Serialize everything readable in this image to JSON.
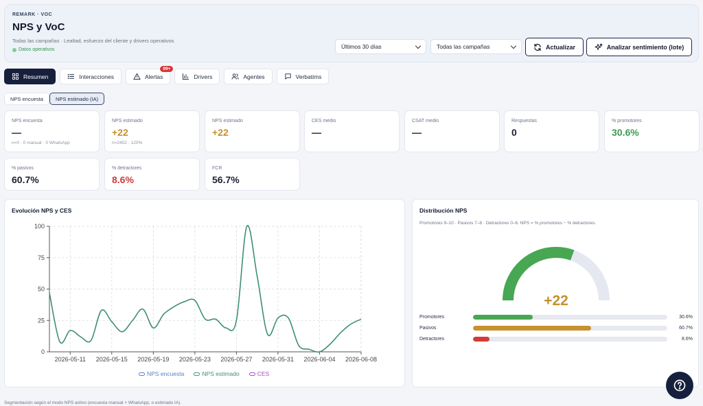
{
  "header": {
    "eyebrow": "REMARK · VOC",
    "title": "NPS y VoC",
    "subtitle": "Todas las campañas · Lealtad, esfuerzo del cliente y drivers operativos",
    "status": "Datos operativos",
    "range_select": "Últimos 30 días",
    "campaign_select": "Todas las campañas",
    "refresh_label": "Actualizar",
    "analyze_label": "Analizar sentimiento (lote)"
  },
  "tabs": [
    {
      "label": "Resumen",
      "icon": "grid-icon"
    },
    {
      "label": "Interacciones",
      "icon": "list-icon"
    },
    {
      "label": "Alertas",
      "icon": "warning-icon",
      "badge": "99+"
    },
    {
      "label": "Drivers",
      "icon": "bar-chart-icon"
    },
    {
      "label": "Agentes",
      "icon": "users-icon"
    },
    {
      "label": "Verbatims",
      "icon": "message-icon"
    }
  ],
  "mode": {
    "survey": "NPS encuesta",
    "estimated": "NPS estimado (IA)"
  },
  "kpis": [
    {
      "label": "NPS encuesta",
      "value": "—",
      "sub": "n=0 · 0 manual · 0 WhatsApp"
    },
    {
      "label": "NPS estimado",
      "value": "+22",
      "sub": "n=2402 · 120%"
    },
    {
      "label": "NPS estimado",
      "value": "+22",
      "sub": ""
    },
    {
      "label": "CES medio",
      "value": "—",
      "sub": ""
    },
    {
      "label": "CSAT medio",
      "value": "—",
      "sub": ""
    },
    {
      "label": "Respuestas",
      "value": "0",
      "sub": ""
    },
    {
      "label": "% promotores",
      "value": "30.6%",
      "sub": ""
    },
    {
      "label": "% pasivos",
      "value": "60.7%",
      "sub": ""
    },
    {
      "label": "% detractores",
      "value": "8.6%",
      "sub": ""
    },
    {
      "label": "FCR",
      "value": "56.7%",
      "sub": ""
    }
  ],
  "evolution": {
    "title": "Evolución NPS y CES"
  },
  "chart_data": {
    "type": "line",
    "title": "Evolución NPS y CES",
    "ylim": [
      0,
      100
    ],
    "yticks": [
      0,
      25,
      50,
      75,
      100
    ],
    "xticks": [
      "2026-05-11",
      "2026-05-15",
      "2026-05-19",
      "2026-05-23",
      "2026-05-27",
      "2026-05-31",
      "2026-06-04",
      "2026-06-08"
    ],
    "x": [
      "2026-05-09",
      "2026-05-10",
      "2026-05-11",
      "2026-05-12",
      "2026-05-13",
      "2026-05-14",
      "2026-05-15",
      "2026-05-16",
      "2026-05-17",
      "2026-05-18",
      "2026-05-19",
      "2026-05-20",
      "2026-05-21",
      "2026-05-22",
      "2026-05-23",
      "2026-05-24",
      "2026-05-25",
      "2026-05-26",
      "2026-05-27",
      "2026-05-28",
      "2026-05-29",
      "2026-05-30",
      "2026-05-31",
      "2026-06-01",
      "2026-06-02",
      "2026-06-03",
      "2026-06-04",
      "2026-06-05",
      "2026-06-06",
      "2026-06-07",
      "2026-06-08"
    ],
    "series": [
      {
        "name": "NPS encuesta",
        "color": "#5b7fc4",
        "values": []
      },
      {
        "name": "NPS estimado",
        "color": "#3e8f74",
        "values": [
          47,
          8,
          17,
          12,
          9,
          33,
          24,
          16,
          25,
          34,
          19,
          30,
          36,
          40,
          41,
          26,
          26,
          19,
          25,
          100,
          60,
          14,
          27,
          27,
          5,
          2,
          0,
          6,
          15,
          22,
          26
        ]
      },
      {
        "name": "CES",
        "color": "#a74cc2",
        "values": []
      }
    ],
    "legend_position": "bottom",
    "grid": true
  },
  "distribution": {
    "title": "Distribución NPS",
    "description": "Promotores 9–10 · Pasivos 7–8 · Detractores 0–6. NPS = % promotores − % detractores.",
    "score": "+22",
    "gauge_fraction": 0.61,
    "rows": [
      {
        "label": "Promotores",
        "pct": "30.6%",
        "value": 30.6,
        "color": "#48a752"
      },
      {
        "label": "Pasivos",
        "pct": "60.7%",
        "value": 60.7,
        "color": "#c8912f"
      },
      {
        "label": "Detractores",
        "pct": "8.6%",
        "value": 8.6,
        "color": "#d33b3b"
      }
    ]
  },
  "footer": "Segmentación según el modo NPS activo (encuesta manual + WhatsApp, o estimado IA)."
}
